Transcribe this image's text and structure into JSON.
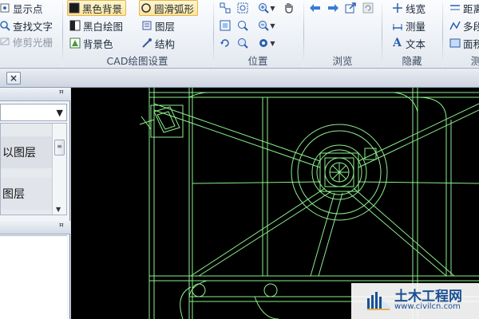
{
  "ribbon": {
    "group0": {
      "items": [
        {
          "label": "显示点",
          "icon": "point-icon"
        },
        {
          "label": "查找文字",
          "icon": "find-text-icon"
        },
        {
          "label": "修剪光栅",
          "icon": "trim-raster-icon",
          "disabled": true
        }
      ]
    },
    "cad_settings": {
      "title": "CAD绘图设置",
      "items": [
        {
          "label": "黑色背景",
          "icon": "black-bg-icon",
          "selected": true
        },
        {
          "label": "圆滑弧形",
          "icon": "smooth-arc-icon",
          "selected": true
        },
        {
          "label": "黑白绘图",
          "icon": "bw-draw-icon"
        },
        {
          "label": "图层",
          "icon": "layers-icon"
        },
        {
          "label": "背景色",
          "icon": "bg-color-icon"
        },
        {
          "label": "结构",
          "icon": "structure-icon"
        }
      ]
    },
    "position": {
      "title": "位置"
    },
    "browse": {
      "title": "浏览"
    },
    "hide": {
      "title": "隐藏",
      "items": [
        {
          "label": "线宽",
          "icon": "line-width-icon"
        },
        {
          "label": "测量",
          "icon": "measure-icon"
        },
        {
          "label": "文本",
          "icon": "text-icon"
        }
      ]
    },
    "measure": {
      "title": "测",
      "items": [
        {
          "label": "距离",
          "icon": "distance-icon"
        },
        {
          "label": "多段",
          "icon": "polyline-icon"
        },
        {
          "label": "面积",
          "icon": "area-icon"
        }
      ]
    }
  },
  "tabs": {
    "close_glyph": "×"
  },
  "left_panel": {
    "pin1": "ꟸ",
    "pin2": "ꟸ",
    "combo_arrow": "▼",
    "list": [
      "以图层",
      "图层"
    ]
  },
  "watermark": {
    "title": "土木工程网",
    "url": "www.civilcn.com"
  },
  "colors": {
    "canvas_bg": "#000000",
    "drawing_line": "#8cf08c",
    "accent": "#1b4f93"
  }
}
